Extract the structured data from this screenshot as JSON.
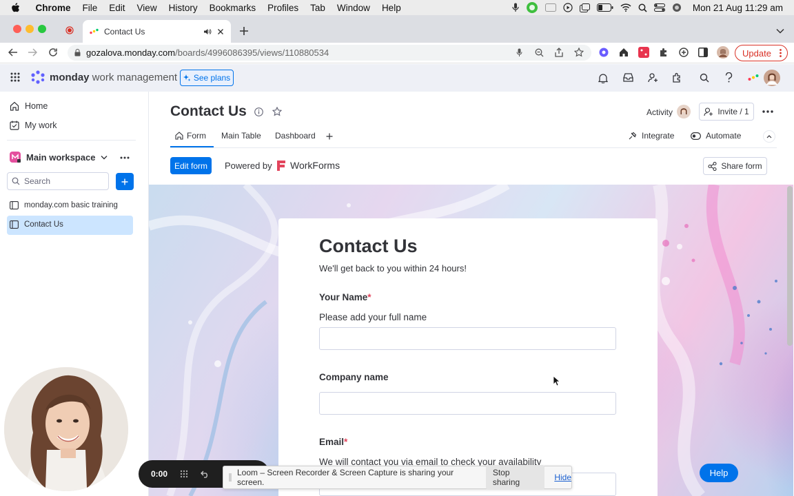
{
  "menubar": {
    "app": "Chrome",
    "items": [
      "File",
      "Edit",
      "View",
      "History",
      "Bookmarks",
      "Profiles",
      "Tab",
      "Window",
      "Help"
    ],
    "clock": "Mon 21 Aug  11:29 am"
  },
  "browser": {
    "tab_title": "Contact Us",
    "url_host": "gozalova.monday.com",
    "url_path": "/boards/4996086395/views/110880534",
    "update_label": "Update"
  },
  "monday_header": {
    "logo_bold": "monday",
    "logo_rest": " work management",
    "see_plans": "See plans"
  },
  "sidebar": {
    "home": "Home",
    "my_work": "My work",
    "workspace": "Main workspace",
    "search_placeholder": "Search",
    "boards": [
      "monday.com basic training",
      "Contact Us"
    ]
  },
  "board": {
    "title": "Contact Us",
    "activity": "Activity",
    "invite": "Invite / 1",
    "tabs": [
      "Form",
      "Main Table",
      "Dashboard"
    ],
    "integrate": "Integrate",
    "automate": "Automate",
    "edit_form": "Edit form",
    "powered_by": "Powered by",
    "workforms": "WorkForms",
    "share_form": "Share form"
  },
  "form": {
    "title": "Contact Us",
    "subtitle": "We'll get back to you within 24 hours!",
    "fields": [
      {
        "label": "Your Name",
        "required": "*",
        "description": "Please add your full name"
      },
      {
        "label": "Company name",
        "required": "",
        "description": ""
      },
      {
        "label": "Email",
        "required": "*",
        "description": "We will contact you via email to check your availability"
      }
    ]
  },
  "loom": {
    "timer": "0:00",
    "sharing_text": "Loom – Screen Recorder & Screen Capture is sharing your screen.",
    "stop_sharing": "Stop sharing",
    "hide": "Hide"
  },
  "help_button": "Help",
  "colors": {
    "primary": "#0073ea",
    "selected": "#cce5ff",
    "required": "#e2445c",
    "update_red": "#d93025"
  }
}
